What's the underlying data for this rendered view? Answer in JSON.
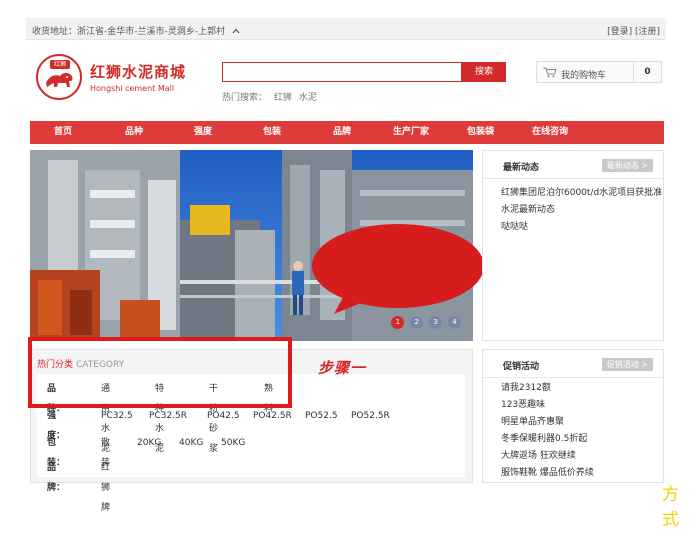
{
  "topbar": {
    "address_label": "收货地址：浙江省-金华市-兰溪市-灵洞乡-上郭村",
    "chevron_icon": "chevron-up-icon",
    "login": "[登录]",
    "register": "[注册]"
  },
  "logo": {
    "badge": "红狮",
    "name_cn": "红狮水泥商城",
    "name_en": "Hongshi cement Mall"
  },
  "search": {
    "value": "",
    "button": "搜索",
    "hot_label": "热门搜索：",
    "hot_items": [
      "红狮",
      "水泥"
    ]
  },
  "cart": {
    "icon": "shopping-cart-icon",
    "label": "我的购物车",
    "count": "0"
  },
  "nav": [
    "首页",
    "品种",
    "强度",
    "包装",
    "品牌",
    "生产厂家",
    "包装袋",
    "在线咨询"
  ],
  "banner": {
    "dots": [
      "1",
      "2",
      "3",
      "4"
    ],
    "active_dot": 0
  },
  "annotations": {
    "bubble_text": "方式二",
    "step_text": "步骤一"
  },
  "news": {
    "title": "最新动态",
    "more": "最新动态 >",
    "items": [
      "红狮集团尼泊尔6000t/d水泥项目获批准",
      "水泥最新动态",
      "哒哒哒"
    ]
  },
  "promo": {
    "title": "促销活动",
    "more": "促销活动 >",
    "items": [
      "请我2312额",
      "123恶趣味",
      "明星单品齐惠聚",
      "冬季保暖利器0.5折起",
      "大牌返场 狂欢继续",
      "服饰鞋靴 爆品低价养续"
    ]
  },
  "category": {
    "title": "热门分类",
    "title_en": "CATEGORY",
    "rows": [
      {
        "key": "品种：",
        "values": [
          "通用水泥",
          "特种水泥",
          "干粉砂浆",
          "熟料"
        ]
      },
      {
        "key": "强度：",
        "values": [
          "PC32.5",
          "PC32.5R",
          "PO42.5",
          "PO42.5R",
          "PO52.5",
          "PO52.5R"
        ]
      },
      {
        "key": "包装：",
        "values": [
          "散装",
          "20KG",
          "40KG",
          "50KG"
        ]
      },
      {
        "key": "品牌：",
        "values": [
          "红狮牌"
        ]
      }
    ]
  },
  "colors": {
    "brand_red": "#d32a2a",
    "nav_red": "#de3b3b",
    "highlight_red": "#e01a1a",
    "bubble_yellow": "#f5d300"
  }
}
